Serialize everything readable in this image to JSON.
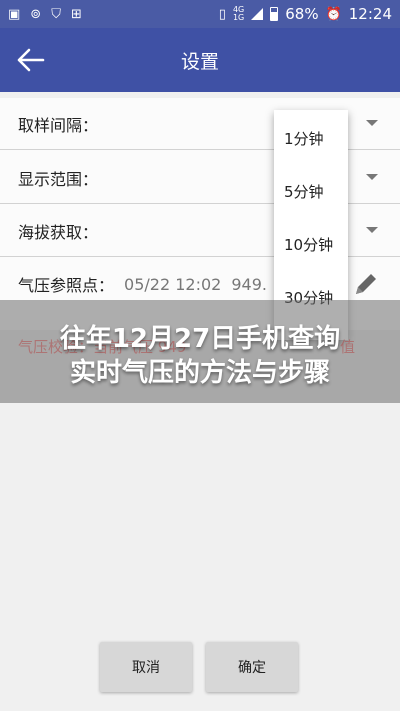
{
  "status_bar": {
    "icons_left": [
      "image-icon",
      "sync-icon",
      "shield-icon",
      "grid-icon"
    ],
    "network": "4G",
    "network_sub": "1G",
    "battery": "68%",
    "time": "12:24"
  },
  "app_bar": {
    "title": "设置"
  },
  "settings": {
    "sampling_label": "取样间隔：",
    "display_label": "显示范围：",
    "altitude_label": "海拔获取：",
    "reference_label": "气压参照点：",
    "reference_time": "05/22 12:02",
    "reference_value": "949."
  },
  "dropdown": {
    "options": [
      "1分钟",
      "5分钟",
      "10分钟",
      "30分钟"
    ]
  },
  "overlay": {
    "behind_left": "气压校验：当前气压 949",
    "behind_right": "值",
    "line1": "往年12月27日手机查询",
    "line2": "实时气压的方法与步骤"
  },
  "buttons": {
    "cancel": "取消",
    "confirm": "确定"
  },
  "colors": {
    "status_bar": "#4a5ba5",
    "app_bar": "#3f51a5",
    "background": "#f0f0f0",
    "button": "#d7d7d7"
  }
}
